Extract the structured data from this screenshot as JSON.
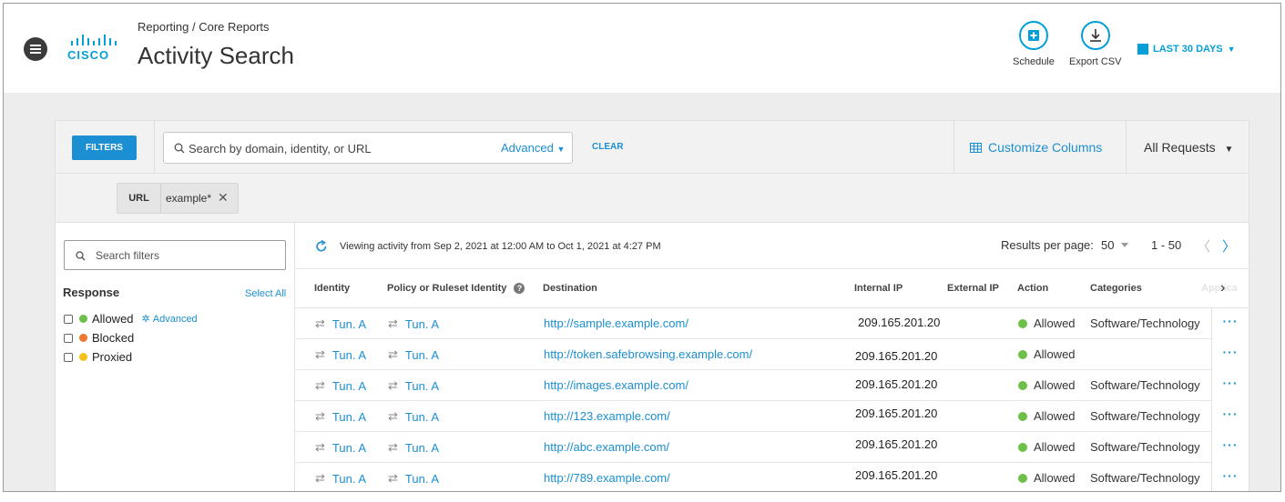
{
  "header": {
    "logo_text": "CISCO",
    "breadcrumb": "Reporting / Core Reports",
    "title": "Activity Search",
    "schedule_label": "Schedule",
    "export_label": "Export CSV",
    "date_range": "LAST 30 DAYS"
  },
  "toolbar": {
    "filters_label": "FILTERS",
    "search_placeholder": "Search by domain, identity, or URL",
    "advanced_label": "Advanced",
    "clear_label": "CLEAR",
    "customize_label": "Customize Columns",
    "requests_label": "All Requests"
  },
  "chip": {
    "key": "URL",
    "value": "example*"
  },
  "sidebar": {
    "search_placeholder": "Search filters",
    "response_title": "Response",
    "select_all": "Select All",
    "options": [
      {
        "label": "Allowed",
        "color": "#6cc04a"
      },
      {
        "label": "Blocked",
        "color": "#f0772d"
      },
      {
        "label": "Proxied",
        "color": "#f5c219"
      }
    ],
    "advanced_link": "Advanced"
  },
  "results": {
    "viewing_text": "Viewing activity from Sep 2, 2021 at 12:00 AM to Oct 1, 2021 at 4:27 PM",
    "per_page_label": "Results per page:",
    "per_page_value": "50",
    "range_label": "1 - 50"
  },
  "table": {
    "columns": [
      "Identity",
      "Policy or Ruleset Identity",
      "Destination",
      "Internal IP",
      "External IP",
      "Action",
      "Categories",
      "Applica"
    ],
    "rows": [
      {
        "identity": "Tun. A",
        "policy": "Tun. A",
        "destination": "http://sample.example.com/",
        "internal_ip": "209.165.201.20",
        "action": "Allowed",
        "categories": "Software/Technology"
      },
      {
        "identity": "Tun. A",
        "policy": "Tun. A",
        "destination": "http://token.safebrowsing.example.com/",
        "internal_ip": "209.165.201.20",
        "action": "Allowed",
        "categories": ""
      },
      {
        "identity": "Tun. A",
        "policy": "Tun. A",
        "destination": "http://images.example.com/",
        "internal_ip": "209.165.201.20",
        "action": "Allowed",
        "categories": "Software/Technology"
      },
      {
        "identity": "Tun. A",
        "policy": "Tun. A",
        "destination": "http://123.example.com/",
        "internal_ip": "209.165.201.20",
        "action": "Allowed",
        "categories": "Software/Technology"
      },
      {
        "identity": "Tun. A",
        "policy": "Tun. A",
        "destination": "http://abc.example.com/",
        "internal_ip": "209.165.201.20",
        "action": "Allowed",
        "categories": "Software/Technology"
      },
      {
        "identity": "Tun. A",
        "policy": "Tun. A",
        "destination": "http://789.example.com/",
        "internal_ip": "209.165.201.20",
        "action": "Allowed",
        "categories": "Software/Technology"
      }
    ],
    "more_label": "···"
  },
  "colors": {
    "accent": "#1b8fd1",
    "allowed": "#6cc04a",
    "cisco_blue": "#049fd9"
  }
}
